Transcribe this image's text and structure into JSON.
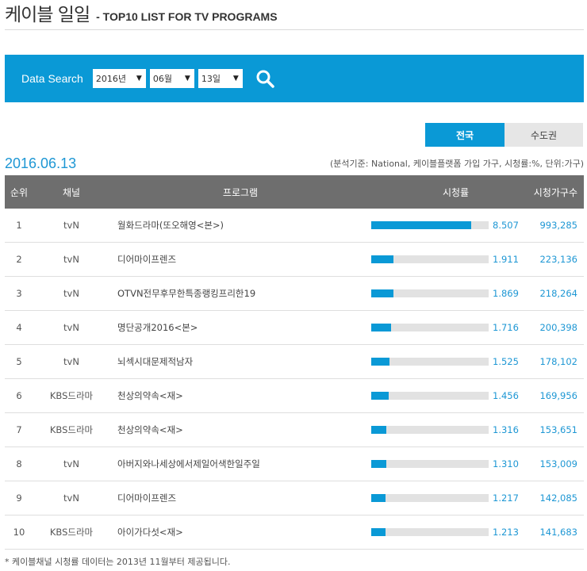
{
  "header": {
    "title": "케이블 일일",
    "subtitle": "- TOP10 LIST FOR TV PROGRAMS"
  },
  "search": {
    "label": "Data Search",
    "year": "2016년",
    "month": "06월",
    "day": "13일"
  },
  "tabs": [
    {
      "label": "전국",
      "active": true
    },
    {
      "label": "수도권",
      "active": false
    }
  ],
  "date": "2016.06.13",
  "note": "(분석기준: National, 케이블플랫폼 가입 가구, 시청률:%, 단위:가구)",
  "table": {
    "headers": [
      "순위",
      "채널",
      "프로그램",
      "시청률",
      "시청가구수"
    ],
    "rows": [
      {
        "rank": "1",
        "channel": "tvN",
        "program": "월화드라마(또오해영<본>)",
        "rating": 8.507,
        "rating_text": "8.507",
        "households": "993,285"
      },
      {
        "rank": "2",
        "channel": "tvN",
        "program": "디어마이프렌즈",
        "rating": 1.911,
        "rating_text": "1.911",
        "households": "223,136"
      },
      {
        "rank": "3",
        "channel": "tvN",
        "program": "OTVN전무후무한특종랭킹프리한19",
        "rating": 1.869,
        "rating_text": "1.869",
        "households": "218,264"
      },
      {
        "rank": "4",
        "channel": "tvN",
        "program": "명단공개2016<본>",
        "rating": 1.716,
        "rating_text": "1.716",
        "households": "200,398"
      },
      {
        "rank": "5",
        "channel": "tvN",
        "program": "뇌섹시대문제적남자",
        "rating": 1.525,
        "rating_text": "1.525",
        "households": "178,102"
      },
      {
        "rank": "6",
        "channel": "KBS드라마",
        "program": "천상의약속<재>",
        "rating": 1.456,
        "rating_text": "1.456",
        "households": "169,956"
      },
      {
        "rank": "7",
        "channel": "KBS드라마",
        "program": "천상의약속<재>",
        "rating": 1.316,
        "rating_text": "1.316",
        "households": "153,651"
      },
      {
        "rank": "8",
        "channel": "tvN",
        "program": "아버지와나세상에서제일어색한일주일",
        "rating": 1.31,
        "rating_text": "1.310",
        "households": "153,009"
      },
      {
        "rank": "9",
        "channel": "tvN",
        "program": "디어마이프렌즈",
        "rating": 1.217,
        "rating_text": "1.217",
        "households": "142,085"
      },
      {
        "rank": "10",
        "channel": "KBS드라마",
        "program": "아이가다섯<재>",
        "rating": 1.213,
        "rating_text": "1.213",
        "households": "141,683"
      }
    ]
  },
  "footnote": "* 케이블채널 시청률 데이터는 2013년 11월부터 제공됩니다.",
  "colors": {
    "accent": "#0a99d6",
    "header_bg": "#6e6e6e",
    "bar_track": "#e2e2e2",
    "value_text": "#1e97d4"
  },
  "icons": {
    "search": "search-icon",
    "dropdown": "triangle-down-icon"
  }
}
